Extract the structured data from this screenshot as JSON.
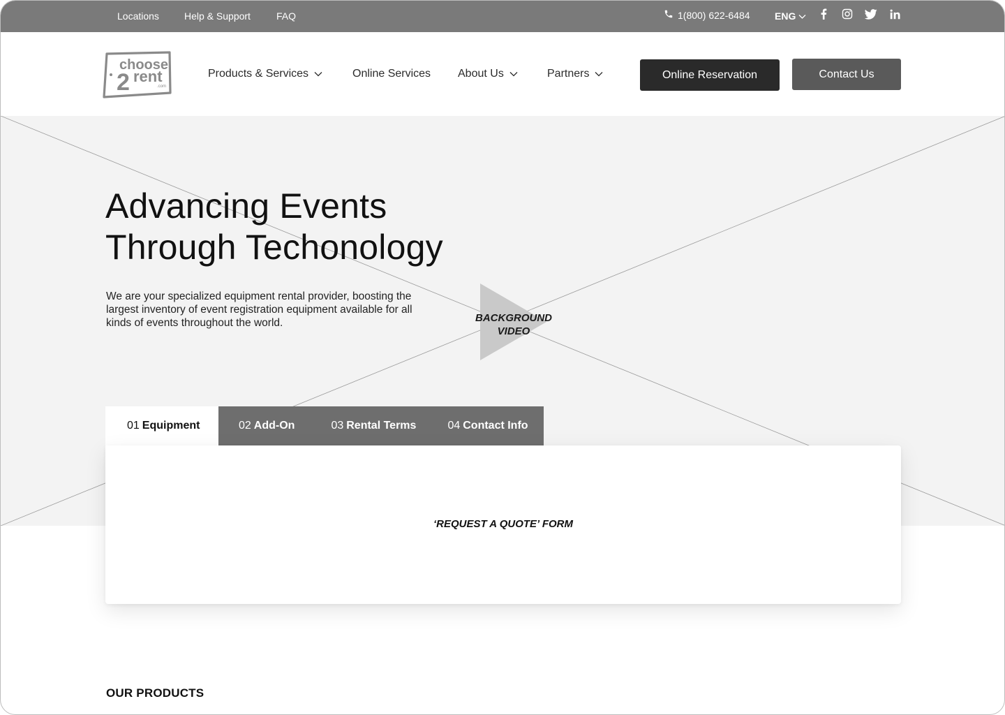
{
  "topbar": {
    "links": [
      "Locations",
      "Help & Support",
      "FAQ"
    ],
    "phone": "1(800) 622-6484",
    "language": "ENG",
    "social_icons": [
      "facebook-icon",
      "instagram-icon",
      "twitter-icon",
      "linkedin-icon"
    ]
  },
  "header": {
    "logo_text": "choose2rent",
    "nav": [
      {
        "label": "Products & Services",
        "dropdown": true
      },
      {
        "label": "Online Services",
        "dropdown": false
      },
      {
        "label": "About Us",
        "dropdown": true
      },
      {
        "label": "Partners",
        "dropdown": true
      }
    ],
    "reserve_label": "Online Reservation",
    "contact_label": "Contact Us"
  },
  "hero": {
    "title_line1": "Advancing Events",
    "title_line2": "Through Techonology",
    "subtitle": "We are your specialized equipment rental provider, boosting the largest inventory of event registration equipment available for all kinds of events throughout the world.",
    "video_label_line1": "BACKGROUND",
    "video_label_line2": "VIDEO"
  },
  "tabs": [
    {
      "num": "01",
      "label": "Equipment",
      "active": true
    },
    {
      "num": "02",
      "label": "Add-On",
      "active": false
    },
    {
      "num": "03",
      "label": "Rental Terms",
      "active": false
    },
    {
      "num": "04",
      "label": "Contact Info",
      "active": false
    }
  ],
  "form": {
    "placeholder_label": "‘REQUEST A QUOTE’ FORM"
  },
  "products": {
    "title": "OUR PRODUCTS"
  },
  "colors": {
    "topbar": "#7a7a7a",
    "hero_bg": "#f3f3f3",
    "reserve_button": "#2a2a2a",
    "contact_button": "#5a5a5a",
    "tab_bar": "#6e6e6e"
  }
}
